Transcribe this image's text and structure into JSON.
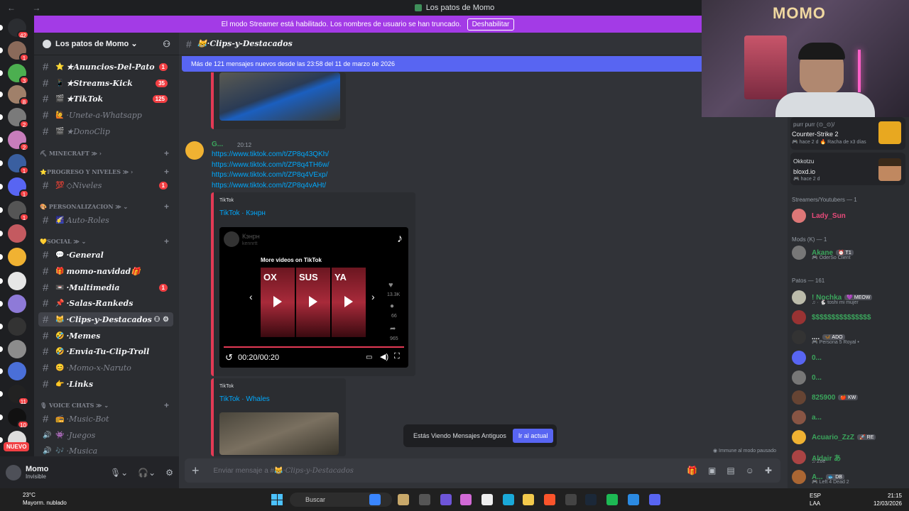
{
  "window": {
    "title": "Los patos de Momo",
    "nav": "← →"
  },
  "banner": {
    "text": "El modo Streamer está habilitado. Los nombres de usuario se han truncado.",
    "button": "Deshabilitar"
  },
  "server": {
    "name": "Los patos de Momo ⌄"
  },
  "guilds": [
    {
      "badge": "42",
      "color": "#2b2d31"
    },
    {
      "badge": "1",
      "color": "#8a6a5a"
    },
    {
      "badge": "3",
      "color": "#4caf50"
    },
    {
      "badge": "8",
      "color": "#a0806a"
    },
    {
      "badge": "2",
      "color": "#7a7a7a"
    },
    {
      "badge": "2",
      "color": "#c77dbb"
    },
    {
      "badge": "1",
      "color": "#3a5fa0"
    },
    {
      "badge": "1",
      "color": "#5865f2"
    },
    {
      "badge": "1",
      "color": "#555"
    },
    {
      "badge": "",
      "color": "#c45a60"
    },
    {
      "badge": "",
      "color": "#f0b232"
    },
    {
      "badge": "",
      "color": "#e6e6e6"
    },
    {
      "badge": "",
      "color": "#8e7ad8"
    },
    {
      "badge": "",
      "color": "#333"
    },
    {
      "badge": "",
      "color": "#8c8c8c"
    },
    {
      "badge": "",
      "color": "#4a6fd8"
    },
    {
      "badge": "11",
      "color": "#222"
    },
    {
      "badge": "10",
      "color": "#111"
    },
    {
      "badge": "",
      "color": "#ddd"
    }
  ],
  "nuevo": "NUEVO",
  "channels": [
    {
      "type": "chan",
      "emo": "⭐",
      "name": "★Anuncios-Del-Pato",
      "badge": "1",
      "muted": false
    },
    {
      "type": "chan",
      "emo": "📱",
      "name": "★Streams-Kick",
      "badge": "35",
      "muted": false
    },
    {
      "type": "chan",
      "emo": "🎬",
      "name": "★TikTok",
      "badge": "125",
      "muted": false
    },
    {
      "type": "chan",
      "emo": "🙋",
      "name": "·Unete-a-Whatsapp",
      "badge": "",
      "muted": true
    },
    {
      "type": "chan",
      "emo": "🎬",
      "name": "★DonoClip",
      "badge": "",
      "muted": true
    },
    {
      "type": "cat",
      "name": "⛏ MINECRAFT ≫ ›"
    },
    {
      "type": "cat",
      "name": "⭐PROGRESO Y NIVELES ≫ ›"
    },
    {
      "type": "chan",
      "emo": "💯",
      "name": "◇Niveles",
      "badge": "1",
      "muted": true
    },
    {
      "type": "cat",
      "name": "🎨 PERSONALIZACION ≫ ⌄"
    },
    {
      "type": "chan",
      "emo": "🌠",
      "name": "Auto-Roles",
      "badge": "",
      "muted": true
    },
    {
      "type": "cat",
      "name": "💛SOCIAL ≫ ⌄"
    },
    {
      "type": "chan",
      "emo": "💬",
      "name": "·General",
      "badge": "",
      "muted": false
    },
    {
      "type": "chan",
      "emo": "🎁",
      "name": "momo-navidad🎁",
      "badge": "",
      "muted": false
    },
    {
      "type": "chan",
      "emo": "📼",
      "name": "·Multimedia",
      "badge": "1",
      "muted": false
    },
    {
      "type": "chan",
      "emo": "📌",
      "name": "·Salas-Rankeds",
      "badge": "",
      "muted": false
    },
    {
      "type": "chan",
      "emo": "😹",
      "name": "·Clips-y-Destacados",
      "badge": "",
      "muted": false,
      "active": true
    },
    {
      "type": "chan",
      "emo": "🤣",
      "name": "·Memes",
      "badge": "",
      "muted": false
    },
    {
      "type": "chan",
      "emo": "🤣",
      "name": "·Envia-Tu-Clip-Troll",
      "badge": "",
      "muted": false
    },
    {
      "type": "chan",
      "emo": "😊",
      "name": "·Momo-x-Naruto",
      "badge": "",
      "muted": true
    },
    {
      "type": "chan",
      "emo": "👉",
      "name": "·Links",
      "badge": "",
      "muted": false
    },
    {
      "type": "cat",
      "name": "🎙 VOICE CHATS ≫ ⌄"
    },
    {
      "type": "chan",
      "emo": "📻",
      "name": "·Music-Bot",
      "badge": "",
      "muted": true
    },
    {
      "type": "voice",
      "emo": "👾",
      "name": "·Juegos",
      "badge": "",
      "muted": true
    },
    {
      "type": "voice",
      "emo": "🎶",
      "name": "·Musica",
      "badge": "",
      "muted": true
    }
  ],
  "user": {
    "name": "Momo",
    "status": "Invisible"
  },
  "chat": {
    "channel": "😹·Clips-y-Destacados",
    "new_bar": "Más de 121 mensajes nuevos desde las 23:58 del 11 de marzo de 2026",
    "message": {
      "author": "G...",
      "time": "20:12",
      "links": [
        "https://www.tiktok.com/t/ZP8q43QKh/",
        "https://www.tiktok.com/t/ZP8q4TH6w/",
        "https://www.tiktok.com/t/ZP8q4VExp/",
        "https://www.tiktok.com/t/ZP8q4vAHt/"
      ]
    },
    "embed1": {
      "provider": "TikTok",
      "title": "TikTok · Кэнрн"
    },
    "video": {
      "channel": "Кэнрн",
      "handle": "kennrtt",
      "more": "More videos on TikTok",
      "tiles": [
        "OX",
        "SUS",
        "YA"
      ],
      "likes": "13.3K",
      "comments": "66",
      "shares": "965",
      "time": "00:20/00:20"
    },
    "embed2": {
      "provider": "TikTok",
      "title": "TikTok · Whales"
    },
    "old_notice": "Estás Viendo Mensajes Antiguos",
    "jump": "Ir al actual",
    "paused": "◉ Immune al modo pausado",
    "composer_prefix": "Enviar mensaje a #😹",
    "composer_channel": "·Clips-y-Destacados"
  },
  "activities": [
    {
      "user": "purr purr (⊙_⊙)/",
      "game": "Counter-Strike 2",
      "meta": "🎮 hace 2 d   🔥 Racha de x3 días"
    },
    {
      "user": "Okkotzu",
      "game": "bloxd.io",
      "meta": "🎮 hace 2 d"
    }
  ],
  "members": {
    "streamers_label": "Streamers/Youtubers — 1",
    "mods_label": "Mods (K) — 1",
    "patos_label": "Patos — 161",
    "list": [
      {
        "name": "Lady_Sun",
        "color": "#e84a7a",
        "sub": "",
        "tag": "",
        "av": "#d77"
      },
      {
        "name": "Akane",
        "color": "#3ba55c",
        "sub": "🎮 OderSo Client",
        "tag": "⏰ T1",
        "av": "#777"
      },
      {
        "name": "! Nochka",
        "color": "#3ba55c",
        "sub": "♫ · 🐇 toshi mi mujer",
        "tag": "💜 MEOW",
        "av": "#bba"
      },
      {
        "name": "$$$$$$$$$$$$$$$",
        "color": "#3ba55c",
        "sub": "",
        "tag": "",
        "av": "#933"
      },
      {
        "name": "....",
        "color": "#f2f3f5",
        "sub": "🎮 Persona 5 Royal •",
        "tag": "🦋 ADO",
        "av": "#333"
      },
      {
        "name": "0...",
        "color": "#3ba55c",
        "sub": "",
        "tag": "",
        "av": "#5865f2"
      },
      {
        "name": "0...",
        "color": "#3ba55c",
        "sub": "",
        "tag": "",
        "av": "#777"
      },
      {
        "name": "825900",
        "color": "#3ba55c",
        "sub": "",
        "tag": "🍎 KW",
        "av": "#643"
      },
      {
        "name": "a...",
        "color": "#3ba55c",
        "sub": "",
        "tag": "",
        "av": "#854"
      },
      {
        "name": "Acuario_ZzZ",
        "color": "#3ba55c",
        "sub": "",
        "tag": "🚀 RE",
        "av": "#f0b232"
      },
      {
        "name": "Aldair あ",
        "color": "#3ba55c",
        "sub": "♫ Zoé",
        "tag": "",
        "av": "#a44"
      },
      {
        "name": "A...",
        "color": "#3ba55c",
        "sub": "🎮 Left 4 Dead 2",
        "tag": "🐟 DB",
        "av": "#a63"
      }
    ]
  },
  "taskbar": {
    "temp": "23°C",
    "weather": "Mayorm. nublado",
    "search": "Buscar",
    "lang1": "ESP",
    "lang2": "LAA",
    "time": "21:15",
    "date": "12/03/2026",
    "icons": [
      {
        "color": "#3a86ff"
      },
      {
        "color": "#c8a86a"
      },
      {
        "color": "#555"
      },
      {
        "color": "#6e55d8"
      },
      {
        "color": "#d26ad6"
      },
      {
        "color": "#eee"
      },
      {
        "color": "#1aa9d8"
      },
      {
        "color": "#f2c94c"
      },
      {
        "color": "#fb542b"
      },
      {
        "color": "#444"
      },
      {
        "color": "#1b2838"
      },
      {
        "color": "#1db954"
      },
      {
        "color": "#2b8ae2"
      },
      {
        "color": "#5865f2"
      }
    ]
  }
}
